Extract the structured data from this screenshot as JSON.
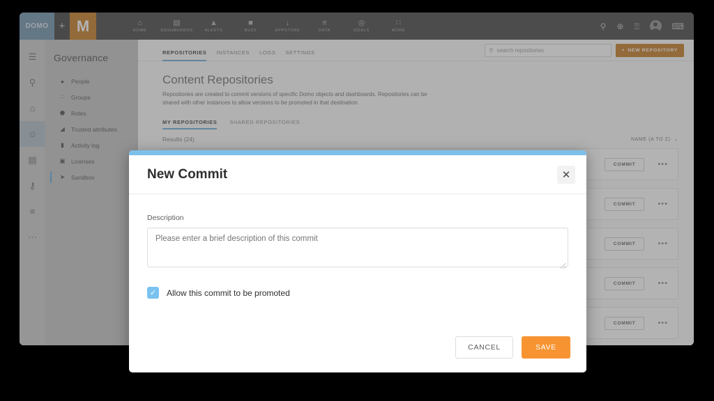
{
  "topnav": {
    "brand_domo": "DOMO",
    "brand_plus": "+",
    "brand_initial": "M",
    "items": [
      {
        "label": "HOME",
        "icon": "home-icon",
        "glyph": "⌂"
      },
      {
        "label": "DASHBOARDS",
        "icon": "dashboards-icon",
        "glyph": "▤"
      },
      {
        "label": "ALERTS",
        "icon": "bell-icon",
        "glyph": "▲"
      },
      {
        "label": "BUZZ",
        "icon": "chat-icon",
        "glyph": "■"
      },
      {
        "label": "APPSTORE",
        "icon": "appstore-icon",
        "glyph": "↓"
      },
      {
        "label": "DATA",
        "icon": "data-icon",
        "glyph": "≡"
      },
      {
        "label": "GOALS",
        "icon": "target-icon",
        "glyph": "◎"
      },
      {
        "label": "MORE",
        "icon": "grid-icon",
        "glyph": "∷"
      }
    ],
    "right_icons": [
      {
        "name": "search-icon",
        "glyph": "⚲"
      },
      {
        "name": "add-icon",
        "glyph": "⊕"
      },
      {
        "name": "help-icon",
        "glyph": "⍰"
      },
      {
        "name": "avatar",
        "glyph": ""
      },
      {
        "name": "messages-icon",
        "glyph": "⌨"
      }
    ]
  },
  "rail": {
    "items": [
      {
        "name": "menu-icon",
        "glyph": "☰",
        "active": false
      },
      {
        "name": "search-icon",
        "glyph": "⚲",
        "active": false
      },
      {
        "name": "home-icon",
        "glyph": "⌂",
        "active": false
      },
      {
        "name": "people-icon",
        "glyph": "☺",
        "active": true
      },
      {
        "name": "reports-icon",
        "glyph": "▤",
        "active": false
      },
      {
        "name": "key-icon",
        "glyph": "⚷",
        "active": false
      },
      {
        "name": "settings-sliders-icon",
        "glyph": "≡",
        "active": false
      },
      {
        "name": "more-icon",
        "glyph": "⋯",
        "active": false
      }
    ]
  },
  "sidebar": {
    "title": "Governance",
    "items": [
      {
        "label": "People",
        "icon": "person-icon",
        "glyph": "●",
        "active": false
      },
      {
        "label": "Groups",
        "icon": "groups-icon",
        "glyph": "∴",
        "active": false
      },
      {
        "label": "Roles",
        "icon": "shield-icon",
        "glyph": "⬟",
        "active": false
      },
      {
        "label": "Trusted attributes",
        "icon": "trusted-attributes-icon",
        "glyph": "◢",
        "active": false
      },
      {
        "label": "Activity log",
        "icon": "document-icon",
        "glyph": "▮",
        "active": false
      },
      {
        "label": "Licenses",
        "icon": "license-card-icon",
        "glyph": "▣",
        "active": false
      },
      {
        "label": "Sandbox",
        "icon": "rocket-icon",
        "glyph": "➤",
        "active": true
      }
    ]
  },
  "main": {
    "tabs": [
      {
        "label": "REPOSITORIES",
        "active": true
      },
      {
        "label": "INSTANCES",
        "active": false
      },
      {
        "label": "LOGS",
        "active": false
      },
      {
        "label": "SETTINGS",
        "active": false
      }
    ],
    "search": {
      "placeholder": "search repositories",
      "value": "",
      "icon": "search-icon"
    },
    "new_repository_button": {
      "label": "NEW REPOSITORY",
      "icon": "plus-icon",
      "glyph": "+"
    },
    "page_title": "Content Repositories",
    "page_description": "Repositories are created to commit versions of specific Domo objects and dashboards. Repositories can be shared with other instances to allow versions to be promoted in that destination.",
    "subtabs": [
      {
        "label": "MY REPOSITORIES",
        "active": true
      },
      {
        "label": "SHARED REPOSITORIES",
        "active": false
      }
    ],
    "results_count": "Results (24)",
    "sort": {
      "label": "NAME (A TO Z)",
      "icon": "chevron-down-icon",
      "glyph": "⌄"
    },
    "rows": [
      {
        "commit_label": "COMMIT",
        "menu_glyph": "•••"
      },
      {
        "commit_label": "COMMIT",
        "menu_glyph": "•••"
      },
      {
        "commit_label": "COMMIT",
        "menu_glyph": "•••"
      },
      {
        "commit_label": "COMMIT",
        "menu_glyph": "•••"
      },
      {
        "commit_label": "COMMIT",
        "menu_glyph": "•••"
      }
    ]
  },
  "modal": {
    "title": "New Commit",
    "close_glyph": "✕",
    "description_label": "Description",
    "description_placeholder": "Please enter a brief description of this commit",
    "description_value": "",
    "checkbox": {
      "label": "Allow this commit to be promoted",
      "checked": true,
      "glyph": "✓"
    },
    "cancel_label": "CANCEL",
    "save_label": "SAVE"
  },
  "colors": {
    "brand_orange": "#c4781e",
    "save_orange": "#f79431",
    "accent_blue": "#7cc0ea",
    "tab_underline": "#6aa7d8",
    "checkbox_blue": "#79c2ef",
    "topnav_dark": "#424242",
    "domo_blue": "#6e91ab"
  }
}
